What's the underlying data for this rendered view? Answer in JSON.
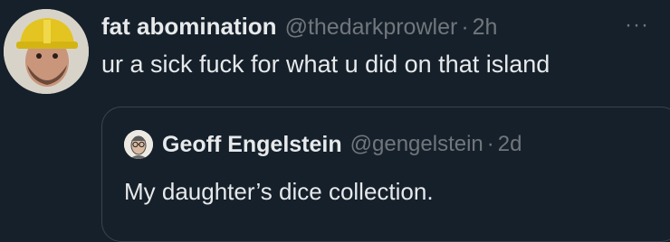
{
  "tweet": {
    "author": {
      "display_name": "fat abomination",
      "handle": "@thedarkprowler",
      "avatar_icon": "user-avatar"
    },
    "separator": "·",
    "timestamp": "2h",
    "more_icon": "more-horizontal-icon",
    "more_glyph": "···",
    "text": "ur a sick fuck for what u did on that island"
  },
  "quoted_tweet": {
    "author": {
      "display_name": "Geoff Engelstein",
      "handle": "@gengelstein",
      "avatar_icon": "user-avatar"
    },
    "separator": "·",
    "timestamp": "2d",
    "text": "My daughter’s dice collection."
  },
  "colors": {
    "background": "#15202b",
    "primary_text": "#e7e9ea",
    "secondary_text": "#71767b",
    "border": "#38444d"
  }
}
